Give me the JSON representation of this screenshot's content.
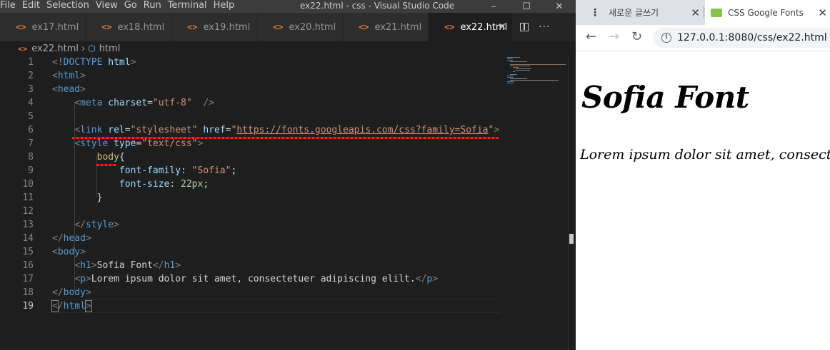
{
  "vscode": {
    "menu": [
      "File",
      "Edit",
      "Selection",
      "View",
      "Go",
      "Run",
      "Terminal",
      "Help"
    ],
    "window_title": "ex22.html - css - Visual Studio Code",
    "tabs": [
      {
        "label": "ex17.html"
      },
      {
        "label": "ex18.html"
      },
      {
        "label": "ex19.html"
      },
      {
        "label": "ex20.html"
      },
      {
        "label": "ex21.html"
      },
      {
        "label": "ex22.html"
      }
    ],
    "breadcrumb": {
      "file": "ex22.html",
      "symbol": "html"
    },
    "line_numbers": [
      "1",
      "2",
      "3",
      "4",
      "5",
      "6",
      "7",
      "8",
      "9",
      "10",
      "11",
      "12",
      "13",
      "14",
      "15",
      "16",
      "17",
      "18",
      "19"
    ]
  },
  "browser": {
    "tabs": [
      {
        "label": "새로운 글쓰기"
      },
      {
        "label": "CSS Google Fonts"
      }
    ],
    "url": "127.0.0.1:8080/css/ex22.html",
    "page": {
      "h1": "Sofia Font",
      "p": "Lorem ipsum dolor sit amet, consectetuer adipiscing elilt."
    }
  }
}
